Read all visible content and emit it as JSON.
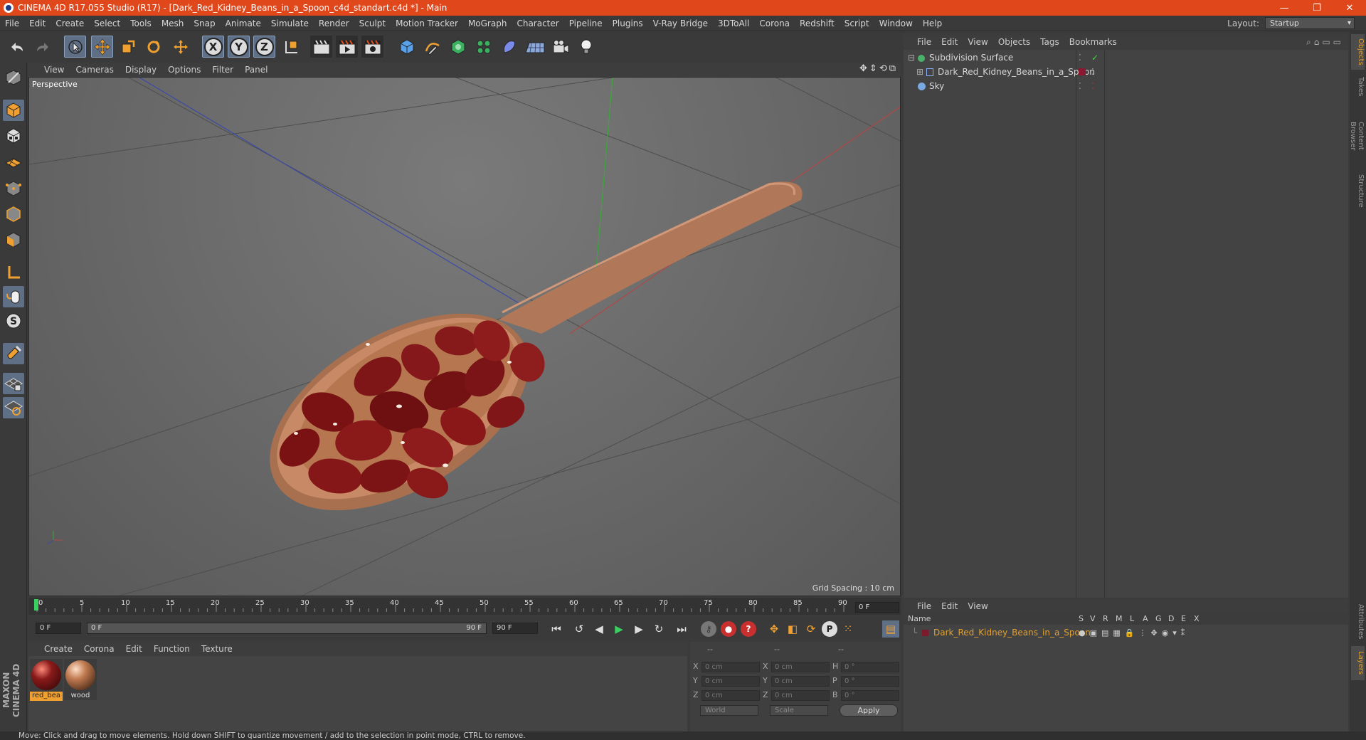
{
  "window": {
    "title": "CINEMA 4D R17.055 Studio (R17) - [Dark_Red_Kidney_Beans_in_a_Spoon_c4d_standart.c4d *] - Main",
    "controls": [
      "—",
      "❐",
      "✕"
    ]
  },
  "menubar": {
    "items": [
      "File",
      "Edit",
      "Create",
      "Select",
      "Tools",
      "Mesh",
      "Snap",
      "Animate",
      "Simulate",
      "Render",
      "Sculpt",
      "Motion Tracker",
      "MoGraph",
      "Character",
      "Pipeline",
      "Plugins",
      "V-Ray Bridge",
      "3DToAll",
      "Corona",
      "Redshift",
      "Script",
      "Window",
      "Help"
    ],
    "layout_label": "Layout:",
    "layout_value": "Startup"
  },
  "toolbar": {
    "axis_x": "X",
    "axis_y": "Y",
    "axis_z": "Z"
  },
  "viewport": {
    "menu": [
      "View",
      "Cameras",
      "Display",
      "Options",
      "Filter",
      "Panel"
    ],
    "label": "Perspective",
    "grid_spacing": "Grid Spacing : 10 cm",
    "nav_icons": "✥⇕⟲⧉"
  },
  "timeline": {
    "ticks": [
      "0",
      "5",
      "10",
      "15",
      "20",
      "25",
      "30",
      "35",
      "40",
      "45",
      "50",
      "55",
      "60",
      "65",
      "70",
      "75",
      "80",
      "85",
      "90"
    ],
    "current_frame": "0 F",
    "start_frame": "0 F",
    "range_start": "0 F",
    "range_end": "90 F",
    "end_frame": "90 F"
  },
  "materials": {
    "menu": [
      "Create",
      "Corona",
      "Edit",
      "Function",
      "Texture"
    ],
    "items": [
      {
        "name": "red_bea",
        "color": "#8a1a1a"
      },
      {
        "name": "wood",
        "color": "#c07a50"
      }
    ]
  },
  "coordinates": {
    "headers": [
      "--",
      "--",
      "--"
    ],
    "rows": [
      {
        "a_label": "X",
        "a_val": "0 cm",
        "b_label": "X",
        "b_val": "0 cm",
        "c_label": "H",
        "c_val": "0 °"
      },
      {
        "a_label": "Y",
        "a_val": "0 cm",
        "b_label": "Y",
        "b_val": "0 cm",
        "c_label": "P",
        "c_val": "0 °"
      },
      {
        "a_label": "Z",
        "a_val": "0 cm",
        "b_label": "Z",
        "b_val": "0 cm",
        "c_label": "B",
        "c_val": "0 °"
      }
    ],
    "mode1": "World",
    "mode2": "Scale",
    "apply": "Apply"
  },
  "objects": {
    "menu": [
      "File",
      "Edit",
      "View",
      "Objects",
      "Tags",
      "Bookmarks"
    ],
    "items": [
      {
        "name": "Subdivision Surface",
        "icon_color": "#4ab06a"
      },
      {
        "name": "Dark_Red_Kidney_Beans_in_a_Spoon",
        "icon_color": "#8ab0ff"
      },
      {
        "name": "Sky",
        "icon_color": "#7aa8e0"
      }
    ]
  },
  "layers": {
    "menu": [
      "File",
      "Edit",
      "View"
    ],
    "columns": [
      "Name",
      "S",
      "V",
      "R",
      "M",
      "L",
      "A",
      "G",
      "D",
      "E",
      "X"
    ],
    "items": [
      {
        "name": "Dark_Red_Kidney_Beans_in_a_Spoon",
        "color": "#7a1a2a"
      }
    ]
  },
  "right_tabs": [
    "Objects",
    "Takes",
    "Content Browser",
    "Structure",
    "Attributes",
    "Layers"
  ],
  "brand": "MAXON CINEMA 4D",
  "status": "Move: Click and drag to move elements. Hold down SHIFT to quantize movement / add to the selection in point mode, CTRL to remove.",
  "colors": {
    "title_bar": "#e0471b",
    "accent_orange": "#e0a030",
    "viewport_bg": "#6b6b6b"
  }
}
